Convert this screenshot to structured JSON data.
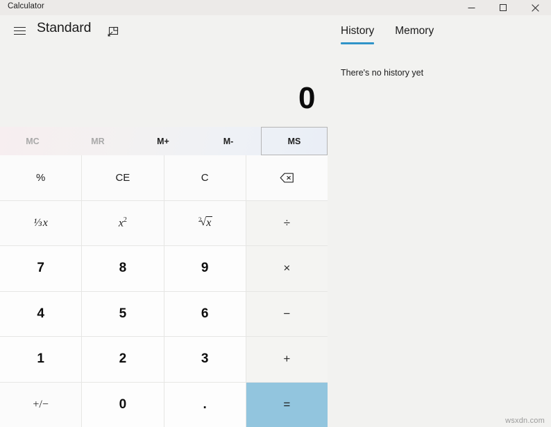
{
  "window": {
    "title": "Calculator",
    "controls": [
      {
        "name": "minimize",
        "glyph": "minimize-icon"
      },
      {
        "name": "maximize",
        "glyph": "maximize-icon"
      },
      {
        "name": "close",
        "glyph": "close-icon"
      }
    ]
  },
  "header": {
    "menu_icon": "hamburger-menu-icon",
    "mode": "Standard",
    "keep_on_top_icon": "keep-on-top-icon"
  },
  "display": {
    "value": "0"
  },
  "memory_row": [
    {
      "label": "MC",
      "enabled": false
    },
    {
      "label": "MR",
      "enabled": false
    },
    {
      "label": "M+",
      "enabled": true
    },
    {
      "label": "M-",
      "enabled": true
    },
    {
      "label": "MS",
      "enabled": true,
      "focused": true
    }
  ],
  "keypad": {
    "rows": [
      [
        {
          "label": "%",
          "kind": "fn",
          "name": "percent"
        },
        {
          "label": "CE",
          "kind": "fn",
          "name": "clear-entry"
        },
        {
          "label": "C",
          "kind": "fn",
          "name": "clear"
        },
        {
          "label": "",
          "kind": "fn",
          "name": "backspace",
          "icon": "backspace-icon"
        }
      ],
      [
        {
          "label": "1/x",
          "kind": "fn",
          "name": "reciprocal",
          "render": "reciprocal"
        },
        {
          "label": "x2",
          "kind": "fn",
          "name": "square",
          "render": "square"
        },
        {
          "label": "2√x",
          "kind": "fn",
          "name": "square-root",
          "render": "sqrt"
        },
        {
          "label": "÷",
          "kind": "op",
          "name": "divide"
        }
      ],
      [
        {
          "label": "7",
          "kind": "num",
          "name": "seven"
        },
        {
          "label": "8",
          "kind": "num",
          "name": "eight"
        },
        {
          "label": "9",
          "kind": "num",
          "name": "nine"
        },
        {
          "label": "×",
          "kind": "op",
          "name": "multiply"
        }
      ],
      [
        {
          "label": "4",
          "kind": "num",
          "name": "four"
        },
        {
          "label": "5",
          "kind": "num",
          "name": "five"
        },
        {
          "label": "6",
          "kind": "num",
          "name": "six"
        },
        {
          "label": "−",
          "kind": "op",
          "name": "subtract"
        }
      ],
      [
        {
          "label": "1",
          "kind": "num",
          "name": "one"
        },
        {
          "label": "2",
          "kind": "num",
          "name": "two"
        },
        {
          "label": "3",
          "kind": "num",
          "name": "three"
        },
        {
          "label": "+",
          "kind": "op",
          "name": "add"
        }
      ],
      [
        {
          "label": "+/−",
          "kind": "fn",
          "name": "plus-minus",
          "render": "plusminus"
        },
        {
          "label": "0",
          "kind": "num",
          "name": "zero"
        },
        {
          "label": ".",
          "kind": "num",
          "name": "decimal-point"
        },
        {
          "label": "=",
          "kind": "equals",
          "name": "equals"
        }
      ]
    ]
  },
  "side_panel": {
    "tabs": [
      {
        "label": "History",
        "active": true
      },
      {
        "label": "Memory",
        "active": false
      }
    ],
    "empty_message": "There's no history yet"
  },
  "watermark": "wsxdn.com",
  "colors": {
    "accent": "#3094c8",
    "equals": "#92c5de",
    "app_bg": "#f2f2f0",
    "key_bg": "#fbfbfb",
    "op_bg": "#f4f4f2"
  }
}
